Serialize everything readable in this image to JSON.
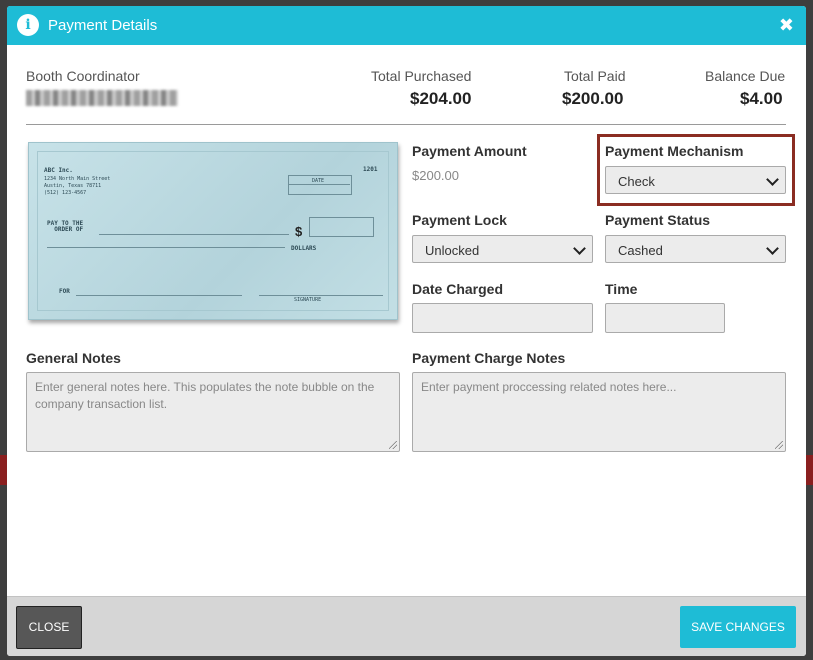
{
  "modal": {
    "title": "Payment Details",
    "close_symbol": "✖",
    "info_icon": "info-icon"
  },
  "summary": {
    "role_label": "Booth Coordinator",
    "total_purchased_label": "Total Purchased",
    "total_purchased_value": "$204.00",
    "total_paid_label": "Total Paid",
    "total_paid_value": "$200.00",
    "balance_due_label": "Balance Due",
    "balance_due_value": "$4.00"
  },
  "check": {
    "company": "ABC Inc.",
    "address_line1": "1234 North Main Street",
    "address_line2": "Austin, Texas 78711",
    "phone": "(512) 123-4567",
    "number": "1201",
    "date_label": "DATE",
    "pay_to_label": "PAY TO THE\n  ORDER OF",
    "dollar_sign": "$",
    "dollars_label": "DOLLARS",
    "for_label": "FOR",
    "signature_label": "SIGNATURE"
  },
  "form": {
    "payment_amount_label": "Payment Amount",
    "payment_amount_value": "$200.00",
    "payment_mechanism_label": "Payment Mechanism",
    "payment_mechanism_value": "Check",
    "payment_lock_label": "Payment Lock",
    "payment_lock_value": "Unlocked",
    "payment_status_label": "Payment Status",
    "payment_status_value": "Cashed",
    "date_charged_label": "Date Charged",
    "date_charged_value": "",
    "time_label": "Time",
    "time_value": "",
    "general_notes_label": "General Notes",
    "general_notes_placeholder": "Enter general notes here.  This populates the note bubble on the company transaction list.",
    "charge_notes_label": "Payment Charge Notes",
    "charge_notes_placeholder": "Enter payment proccessing related notes here..."
  },
  "footer": {
    "close_label": "CLOSE",
    "save_label": "SAVE CHANGES"
  },
  "colors": {
    "accent": "#1ebcd6",
    "highlight": "#8b2d22",
    "close_button": "#575757"
  }
}
